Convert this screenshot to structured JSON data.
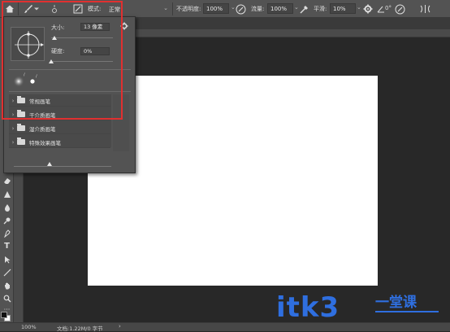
{
  "options_bar": {
    "mode_label": "模式:",
    "mode_value": "正常",
    "opacity_label": "不透明度:",
    "opacity_value": "100%",
    "flow_label": "流量:",
    "flow_value": "100%",
    "smoothing_label": "平滑:",
    "smoothing_value": "10%",
    "angle_value": "0°"
  },
  "brush_panel": {
    "size_label": "大小:",
    "size_value": "13 像素",
    "hardness_label": "硬度:",
    "hardness_value": "0%",
    "size_slider_fraction": 0.05,
    "hardness_slider_fraction": 0.0,
    "bottom_slider_fraction": 0.37,
    "folders": [
      {
        "label": "常规画笔"
      },
      {
        "label": "干介质画笔"
      },
      {
        "label": "湿介质画笔"
      },
      {
        "label": "特殊效果画笔"
      }
    ]
  },
  "status_bar": {
    "zoom": "100%",
    "doc_info": "文档:1.22M/0 字节"
  },
  "watermark": {
    "text": "itk3",
    "cn": "一堂课"
  },
  "colors": {
    "highlight": "#e03030",
    "watermark": "#2f6fe0",
    "workspace": "#282828",
    "panel": "#535353"
  }
}
